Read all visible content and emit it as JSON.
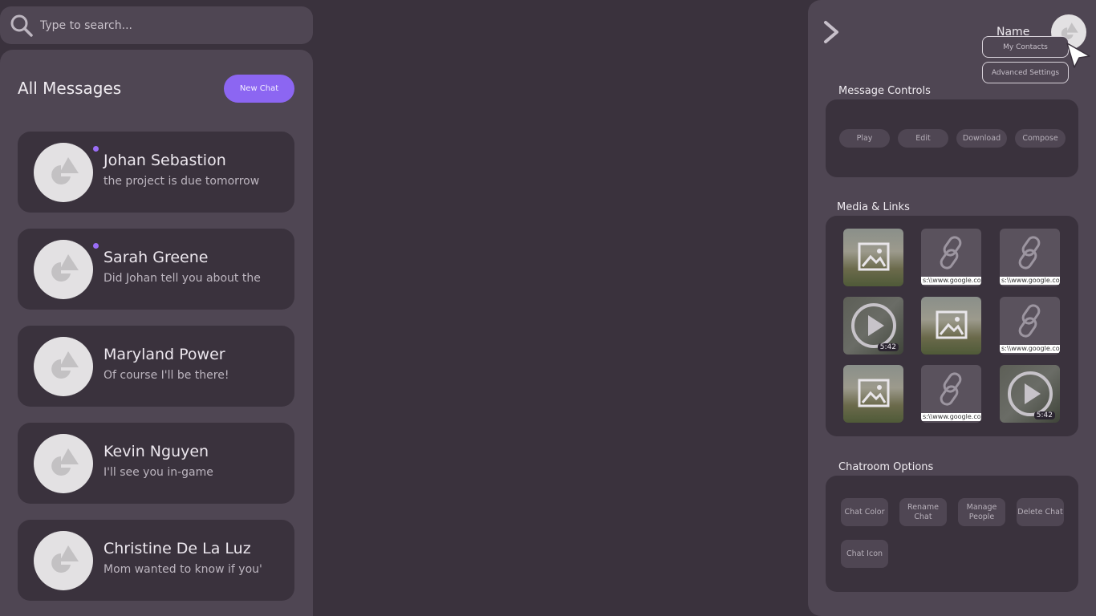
{
  "search": {
    "placeholder": "Type to search..."
  },
  "messages": {
    "title": "All Messages",
    "new_chat_label": "New Chat",
    "chats": [
      {
        "name": "Johan Sebastion",
        "preview": "the project is due tomorrow",
        "unread": true
      },
      {
        "name": "Sarah Greene",
        "preview": "Did Johan tell you about the",
        "unread": true
      },
      {
        "name": "Maryland Power",
        "preview": "Of course I'll be there!",
        "unread": false
      },
      {
        "name": "Kevin Nguyen",
        "preview": "I'll see you in-game",
        "unread": false
      },
      {
        "name": "Christine De La Luz",
        "preview": "Mom wanted to know if you'",
        "unread": false
      }
    ]
  },
  "profile": {
    "name": "Name",
    "menu": [
      "My Contacts",
      "Advanced Settings"
    ]
  },
  "message_controls": {
    "title": "Message Controls",
    "buttons": [
      "Play",
      "Edit",
      "Download",
      "Compose"
    ]
  },
  "media_links": {
    "title": "Media & Links",
    "items": [
      {
        "type": "photo"
      },
      {
        "type": "link",
        "url": "s:\\\\www.google.co"
      },
      {
        "type": "link",
        "url": "s:\\\\www.google.co"
      },
      {
        "type": "video",
        "duration": "5:42"
      },
      {
        "type": "photo"
      },
      {
        "type": "link",
        "url": "s:\\\\www.google.co"
      },
      {
        "type": "photo"
      },
      {
        "type": "link",
        "url": "s:\\\\www.google.co"
      },
      {
        "type": "video",
        "duration": "5:42"
      }
    ]
  },
  "chatroom_options": {
    "title": "Chatroom Options",
    "buttons": [
      "Chat Color",
      "Rename Chat",
      "Manage People",
      "Delete Chat",
      "Chat Icon"
    ]
  },
  "colors": {
    "accent": "#8c66f2",
    "panel": "#4f4653",
    "background": "#3a323d"
  },
  "icons": [
    "search-icon",
    "chevron-right-icon",
    "avatar-placeholder-icon",
    "image-icon",
    "link-icon",
    "play-icon",
    "cursor-icon"
  ]
}
